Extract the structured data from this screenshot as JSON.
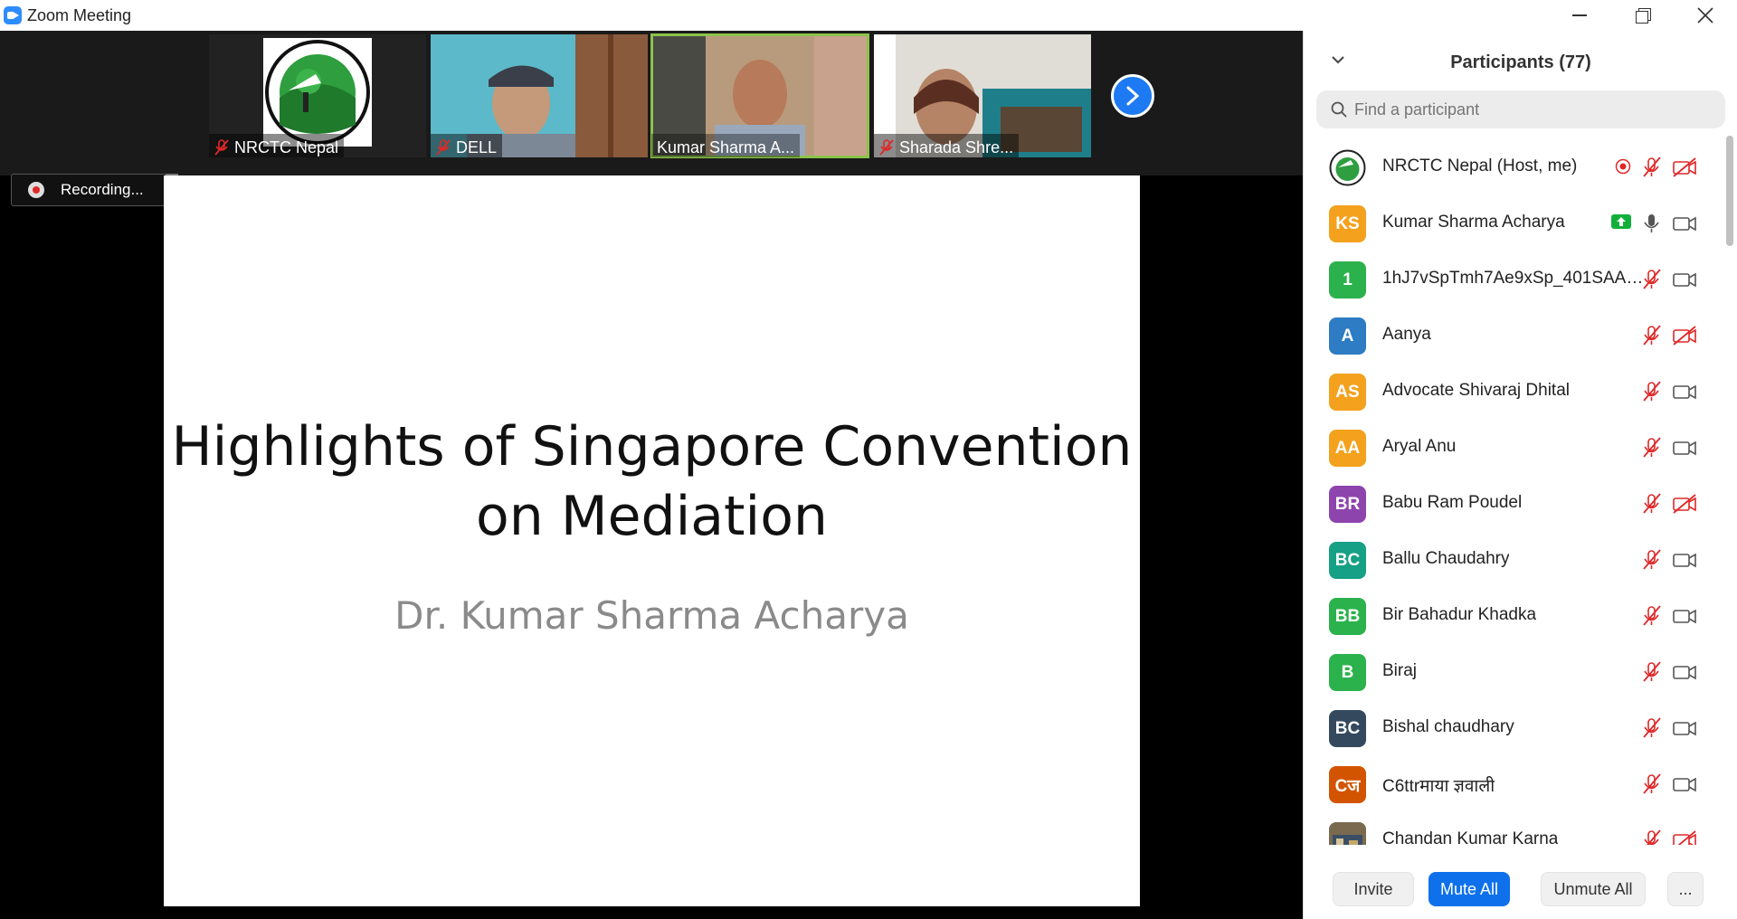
{
  "window": {
    "title": "Zoom Meeting"
  },
  "filmstrip": {
    "tiles": [
      {
        "name": "NRCTC Nepal",
        "muted": true
      },
      {
        "name": "DELL",
        "muted": true
      },
      {
        "name": "Kumar Sharma A...",
        "muted": false
      },
      {
        "name": "Sharada Shre...",
        "muted": true
      }
    ]
  },
  "recording": {
    "label": "Recording..."
  },
  "slide": {
    "title_line1": "Highlights of Singapore Convention",
    "title_line2": "on Mediation",
    "subtitle": "Dr. Kumar Sharma Acharya"
  },
  "participants_panel": {
    "title": "Participants (77)",
    "search_placeholder": "Find a participant",
    "participants": [
      {
        "initials": "",
        "name": "NRCTC Nepal (Host, me)",
        "avatar_color": "#2e7d32",
        "mic": "muted",
        "cam": "off",
        "extra": "recording"
      },
      {
        "initials": "KS",
        "name": "Kumar Sharma Acharya",
        "avatar_color": "#f4a11d",
        "mic": "on",
        "cam": "on",
        "extra": "sharing"
      },
      {
        "initials": "1",
        "name": "1hJ7vSpTmh7Ae9xSp_401SAAA...",
        "avatar_color": "#2bb24c",
        "mic": "muted",
        "cam": "on",
        "extra": ""
      },
      {
        "initials": "A",
        "name": "Aanya",
        "avatar_color": "#2d7cc4",
        "mic": "muted",
        "cam": "off",
        "extra": ""
      },
      {
        "initials": "AS",
        "name": "Advocate Shivaraj Dhital",
        "avatar_color": "#f4a11d",
        "mic": "muted",
        "cam": "on",
        "extra": ""
      },
      {
        "initials": "AA",
        "name": "Aryal Anu",
        "avatar_color": "#f4a11d",
        "mic": "muted",
        "cam": "on",
        "extra": ""
      },
      {
        "initials": "BR",
        "name": "Babu Ram Poudel",
        "avatar_color": "#8e44ad",
        "mic": "muted",
        "cam": "off",
        "extra": ""
      },
      {
        "initials": "BC",
        "name": "Ballu Chaudahry",
        "avatar_color": "#16a085",
        "mic": "muted",
        "cam": "on",
        "extra": ""
      },
      {
        "initials": "BB",
        "name": "Bir Bahadur Khadka",
        "avatar_color": "#2bb24c",
        "mic": "muted",
        "cam": "on",
        "extra": ""
      },
      {
        "initials": "B",
        "name": "Biraj",
        "avatar_color": "#2bb24c",
        "mic": "muted",
        "cam": "on",
        "extra": ""
      },
      {
        "initials": "BC",
        "name": "Bishal chaudhary",
        "avatar_color": "#34495e",
        "mic": "muted",
        "cam": "on",
        "extra": ""
      },
      {
        "initials": "Cज",
        "name": "C6ttrमाया ज्ञवाली",
        "avatar_color": "#d35400",
        "mic": "muted",
        "cam": "on",
        "extra": ""
      },
      {
        "initials": "",
        "name": "Chandan Kumar Karna",
        "avatar_color": "#7a6a4f",
        "mic": "muted",
        "cam": "off",
        "extra": ""
      }
    ]
  },
  "footer": {
    "invite": "Invite",
    "mute_all": "Mute All",
    "unmute_all": "Unmute All",
    "more": "..."
  },
  "colors": {
    "accent": "#0e71eb",
    "muted_red": "#e02828",
    "active_tile": "#8bc34a"
  }
}
